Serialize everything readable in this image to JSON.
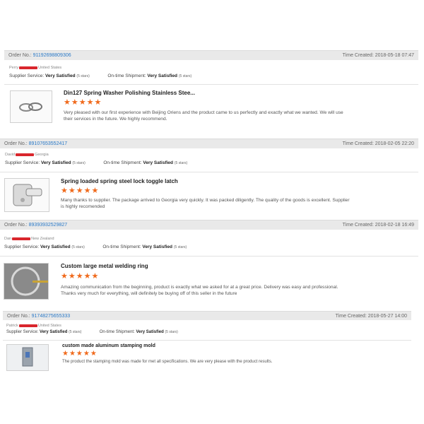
{
  "orders": [
    {
      "order_label": "Order No.:",
      "order_no": "91192698809306",
      "time_label": "Time Created:",
      "time": "2018-05-18 07:47",
      "buyer_name": "Perry",
      "buyer_country": "United States",
      "supplier_label": "Supplier Service:",
      "supplier_value": "Very Satisfied",
      "supplier_stars": "(5 stars)",
      "shipment_label": "On-time Shipment:",
      "shipment_value": "Very Satisfied",
      "shipment_stars": "(5 stars)",
      "product_title": "Din127 Spring Washer Polishing Stainless Stee...",
      "stars": "★★★★★",
      "rating": 5,
      "review": "Very pleased with our first experience with Beijing Oriens and the product came to us perfectly and exactly what we wanted. We will use their services in the future. We highly recommend."
    },
    {
      "order_label": "Order No.:",
      "order_no": "89107653552417",
      "time_label": "Time Created:",
      "time": "2018-02-05 22:20",
      "buyer_name": "David",
      "buyer_country": "Georgia",
      "supplier_label": "Supplier Service:",
      "supplier_value": "Very Satisfied",
      "supplier_stars": "(5 stars)",
      "shipment_label": "On-time Shipment:",
      "shipment_value": "Very Satisfied",
      "shipment_stars": "(5 stars)",
      "product_title": "Spring loaded spring steel lock toggle latch",
      "stars": "★★★★★",
      "rating": 5,
      "review": "Many thanks to supplier. The package arrived to Georgia very quickly. It was packed diligently. The quality of the goods is excellent. Supplier is highly recomended"
    },
    {
      "order_label": "Order No.:",
      "order_no": "89393932529827",
      "time_label": "Time Created:",
      "time": "2018-02-18 16:49",
      "buyer_name": "Dan",
      "buyer_country": "New Zealand",
      "supplier_label": "Supplier Service:",
      "supplier_value": "Very Satisfied",
      "supplier_stars": "(5 stars)",
      "shipment_label": "On-time Shipment:",
      "shipment_value": "Very Satisfied",
      "shipment_stars": "(5 stars)",
      "product_title": "Custom large metal welding ring",
      "stars": "★★★★★",
      "rating": 5,
      "review": "Amazing communication from the beginning, product is exactly what we asked for at a great price. Delivery was easy and professional. Thanks very much for everything, will definitely be buying off of this seller in the future"
    },
    {
      "order_label": "Order No.:",
      "order_no": "91748275655333",
      "time_label": "Time Created:",
      "time": "2018-05-27 14:00",
      "buyer_name": "Patrick",
      "buyer_country": "United States",
      "supplier_label": "Supplier Service:",
      "supplier_value": "Very Satisfied",
      "supplier_stars": "(5 stars)",
      "shipment_label": "On-time Shipment:",
      "shipment_value": "Very Satisfied",
      "shipment_stars": "(5 stars)",
      "product_title": "custom made aluminum stamping mold",
      "stars": "★★★★★",
      "rating": 5,
      "review": "The product the stamping mold was made for met all specifications. We are very please with the product results."
    }
  ],
  "colors": {
    "link": "#2a79c7",
    "star": "#f06a1c",
    "redaction": "#d9262c",
    "bar": "#e9e9e9"
  }
}
